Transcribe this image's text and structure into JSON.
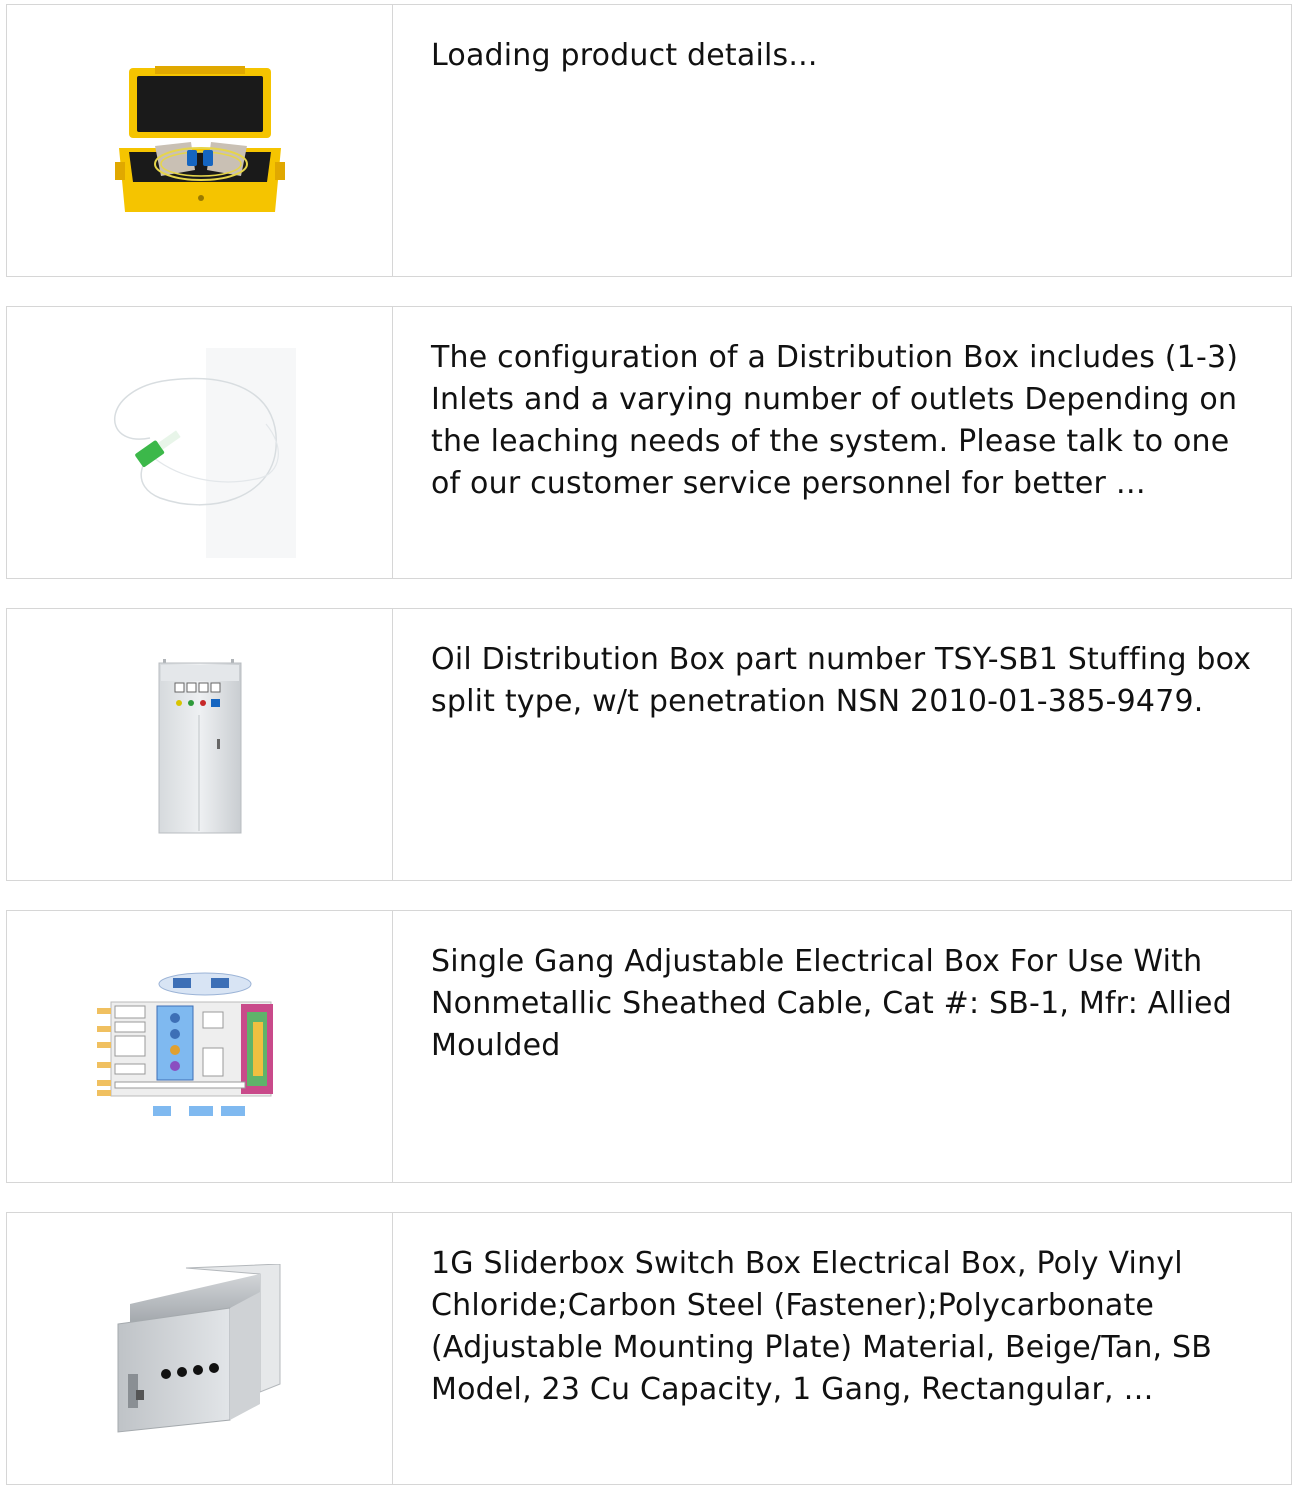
{
  "products": [
    {
      "description": "Loading product details...",
      "image": "yellow-fiber-optic-launch-cable-case"
    },
    {
      "description": "The configuration of a Distribution Box includes (1-3) Inlets and a varying number of outlets Depending on the leaching needs of the system. Please talk to one of our customer service personnel for better …",
      "image": "fiber-pigtail-green-sc-connector"
    },
    {
      "description": "Oil Distribution Box part number TSY-SB1 Stuffing box split type, w/t penetration NSN 2010-01-385-9479.",
      "image": "stainless-steel-distribution-cabinet"
    },
    {
      "description": "Single Gang Adjustable Electrical Box For Use With Nonmetallic Sheathed Cable, Cat #: SB-1, Mfr: Allied Moulded",
      "image": "network-architecture-diagram"
    },
    {
      "description": "1G Sliderbox Switch Box Electrical Box, Poly Vinyl Chloride;Carbon Steel (Fastener);Polycarbonate (Adjustable Mounting Plate) Material, Beige/Tan, SB Model, 23 Cu Capacity, 1 Gang, Rectangular, …",
      "image": "stainless-steel-wall-box"
    }
  ],
  "colors": {
    "border": "#d6d6d6",
    "text": "#111111",
    "case_yellow": "#f5c400",
    "connector_green": "#3cb84a",
    "connector_blue": "#1565c0"
  }
}
